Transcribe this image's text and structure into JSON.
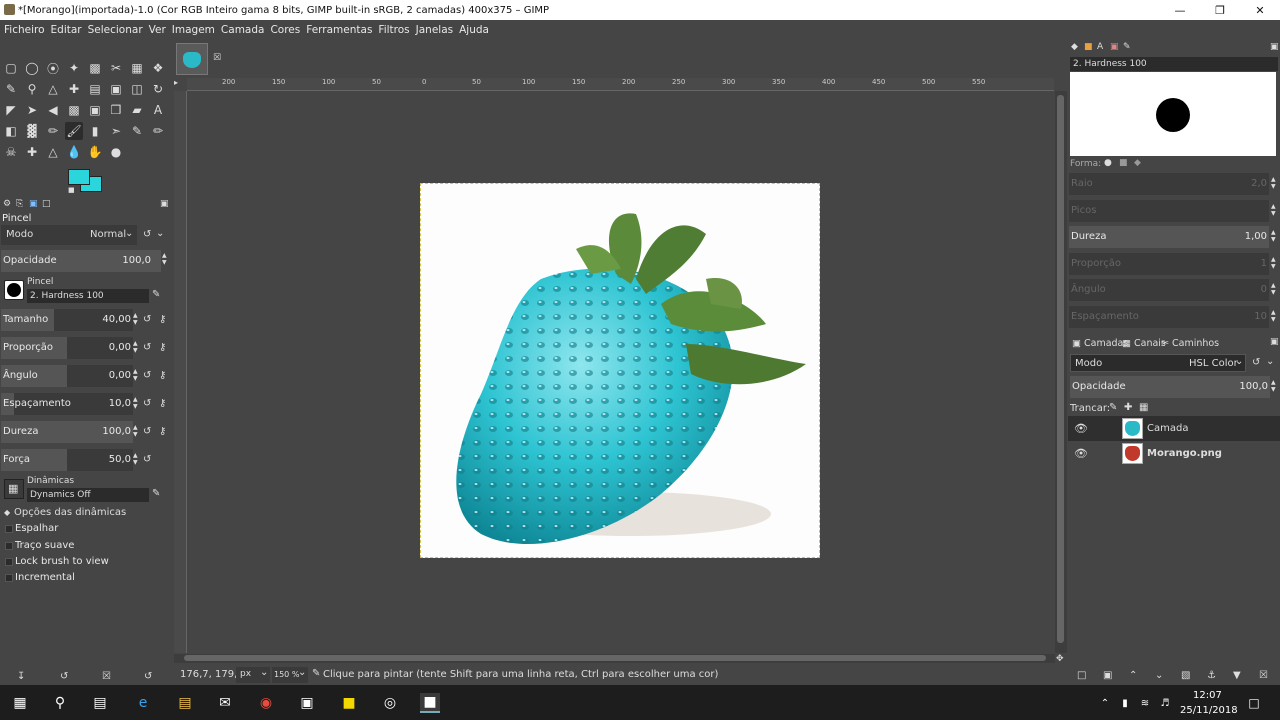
{
  "window": {
    "title": "*[Morango](importada)-1.0 (Cor RGB Inteiro gama 8 bits, GIMP built-in sRGB, 2 camadas) 400x375 – GIMP"
  },
  "menu": [
    "Ficheiro",
    "Editar",
    "Selecionar",
    "Ver",
    "Imagem",
    "Camada",
    "Cores",
    "Ferramentas",
    "Filtros",
    "Janelas",
    "Ajuda"
  ],
  "tool_options": {
    "title": "Pincel",
    "mode_label": "Modo",
    "mode_value": "Normal",
    "opacity_label": "Opacidade",
    "opacity_value": "100,0",
    "brush_label": "Pincel",
    "brush_value": "2. Hardness 100",
    "sliders": [
      {
        "label": "Tamanho",
        "value": "40,00",
        "fill": 0.4
      },
      {
        "label": "Proporção",
        "value": "0,00",
        "fill": 0.5
      },
      {
        "label": "Ângulo",
        "value": "0,00",
        "fill": 0.5
      },
      {
        "label": "Espaçamento",
        "value": "10,0",
        "fill": 0.1
      },
      {
        "label": "Dureza",
        "value": "100,0",
        "fill": 1.0
      },
      {
        "label": "Força",
        "value": "50,0",
        "fill": 0.5
      }
    ],
    "dynamics_label": "Dinâmicas",
    "dynamics_value": "Dynamics Off",
    "dynamics_options": "Opções das dinâmicas",
    "checks": [
      "Espalhar",
      "Traço suave",
      "Lock brush to view",
      "Incremental"
    ]
  },
  "ruler_ticks": [
    "200",
    "150",
    "100",
    "50",
    "0",
    "50",
    "100",
    "150",
    "200",
    "250",
    "300",
    "350",
    "400",
    "450",
    "500",
    "550"
  ],
  "status": {
    "coords": "176,7, 179,3",
    "unit": "px",
    "zoom": "150 %",
    "message": "Clique para pintar (tente Shift para uma linha reta, Ctrl para escolher uma cor)"
  },
  "brushes_panel": {
    "brush_name": "2. Hardness 100",
    "shape_label": "Forma:",
    "rows": [
      {
        "label": "Raio",
        "value": "2,0",
        "dim": true
      },
      {
        "label": "Picos",
        "value": "",
        "dim": true
      },
      {
        "label": "Dureza",
        "value": "1,00",
        "dim": false
      },
      {
        "label": "Proporção",
        "value": "1",
        "dim": true
      },
      {
        "label": "Ângulo",
        "value": "0",
        "dim": true
      },
      {
        "label": "Espaçamento",
        "value": "10",
        "dim": true
      }
    ]
  },
  "layers_panel": {
    "tabs": [
      "Camadas",
      "Canais",
      "Caminhos"
    ],
    "mode_label": "Modo",
    "mode_value": "HSL Color",
    "opacity_label": "Opacidade",
    "opacity_value": "100,0",
    "lock_label": "Trancar:",
    "layers": [
      {
        "name": "Camada",
        "selected": true,
        "bold": false
      },
      {
        "name": "Morango.png",
        "selected": false,
        "bold": true
      }
    ]
  },
  "taskbar": {
    "time": "12:07",
    "date": "25/11/2018"
  },
  "colors": {
    "fg": "#2ad6dc",
    "bg": "#2ad6dc",
    "strawberry": "#1fb8c8"
  }
}
